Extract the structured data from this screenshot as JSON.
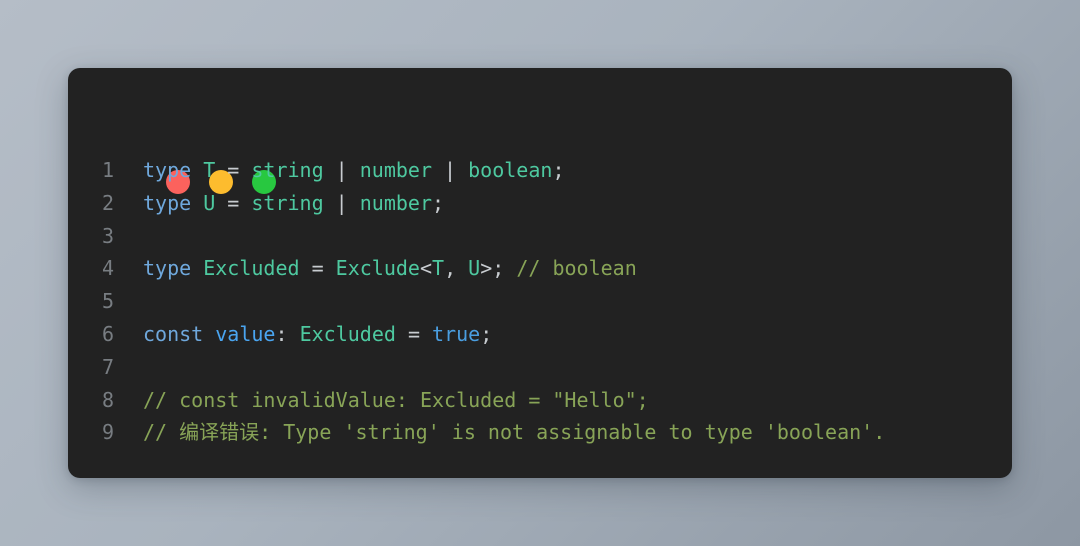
{
  "window": {
    "background_top": "#b5bdc7",
    "background_bottom": "#8d97a3",
    "surface_color": "#222222",
    "controls": [
      {
        "name": "close",
        "label": "Close",
        "color": "#fc625d"
      },
      {
        "name": "minimize",
        "label": "Minimize",
        "color": "#fdbc2e"
      },
      {
        "name": "maximize",
        "label": "Maximize",
        "color": "#28c840"
      }
    ]
  },
  "editor": {
    "language": "TypeScript",
    "line_number_color": "#787d82",
    "colors": {
      "keyword": "#6fa8dc",
      "variable": "#4aa5f0",
      "type": "#4ec9a0",
      "punctuation": "#c8ccd0",
      "comment": "#88a457",
      "boolean": "#4a9ee0"
    },
    "line_numbers": [
      "1",
      "2",
      "3",
      "4",
      "5",
      "6",
      "7",
      "8",
      "9"
    ],
    "lines": [
      {
        "number": "1",
        "text": "type T = string | number | boolean;",
        "tokens": [
          {
            "t": "type",
            "c": "kw"
          },
          {
            "t": " ",
            "c": "punc"
          },
          {
            "t": "T",
            "c": "type"
          },
          {
            "t": " = ",
            "c": "punc"
          },
          {
            "t": "string",
            "c": "type"
          },
          {
            "t": " | ",
            "c": "punc"
          },
          {
            "t": "number",
            "c": "type"
          },
          {
            "t": " | ",
            "c": "punc"
          },
          {
            "t": "boolean",
            "c": "type"
          },
          {
            "t": ";",
            "c": "punc"
          }
        ]
      },
      {
        "number": "2",
        "text": "type U = string | number;",
        "tokens": [
          {
            "t": "type",
            "c": "kw"
          },
          {
            "t": " ",
            "c": "punc"
          },
          {
            "t": "U",
            "c": "type"
          },
          {
            "t": " = ",
            "c": "punc"
          },
          {
            "t": "string",
            "c": "type"
          },
          {
            "t": " | ",
            "c": "punc"
          },
          {
            "t": "number",
            "c": "type"
          },
          {
            "t": ";",
            "c": "punc"
          }
        ]
      },
      {
        "number": "3",
        "text": "",
        "tokens": []
      },
      {
        "number": "4",
        "text": "type Excluded = Exclude<T, U>; // boolean",
        "tokens": [
          {
            "t": "type",
            "c": "kw"
          },
          {
            "t": " ",
            "c": "punc"
          },
          {
            "t": "Excluded",
            "c": "type"
          },
          {
            "t": " = ",
            "c": "punc"
          },
          {
            "t": "Exclude",
            "c": "type"
          },
          {
            "t": "<",
            "c": "punc"
          },
          {
            "t": "T",
            "c": "type"
          },
          {
            "t": ", ",
            "c": "punc"
          },
          {
            "t": "U",
            "c": "type"
          },
          {
            "t": ">; ",
            "c": "punc"
          },
          {
            "t": "// boolean",
            "c": "comment"
          }
        ]
      },
      {
        "number": "5",
        "text": "",
        "tokens": []
      },
      {
        "number": "6",
        "text": "const value: Excluded = true;",
        "tokens": [
          {
            "t": "const",
            "c": "kw"
          },
          {
            "t": " ",
            "c": "punc"
          },
          {
            "t": "value",
            "c": "kw2"
          },
          {
            "t": ": ",
            "c": "punc"
          },
          {
            "t": "Excluded",
            "c": "type"
          },
          {
            "t": " = ",
            "c": "punc"
          },
          {
            "t": "true",
            "c": "bool"
          },
          {
            "t": ";",
            "c": "punc"
          }
        ]
      },
      {
        "number": "7",
        "text": "",
        "tokens": []
      },
      {
        "number": "8",
        "text": "// const invalidValue: Excluded = \"Hello\";",
        "tokens": [
          {
            "t": "// const invalidValue: Excluded = \"Hello\";",
            "c": "comment"
          }
        ]
      },
      {
        "number": "9",
        "text": "// 编译错误: Type 'string' is not assignable to type 'boolean'.",
        "tokens": [
          {
            "t": "// 编译错误: Type 'string' is not assignable to type 'boolean'.",
            "c": "comment"
          }
        ]
      }
    ]
  }
}
